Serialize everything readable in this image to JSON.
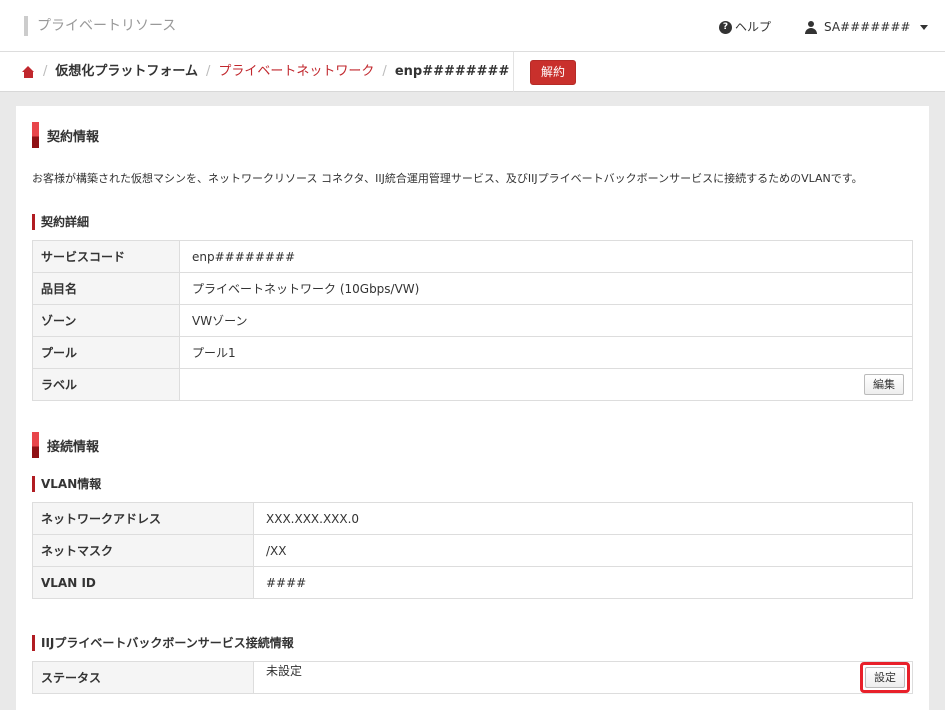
{
  "header": {
    "app_title": "プライベートリソース",
    "help_label": "ヘルプ",
    "user_name": "SA#######"
  },
  "breadcrumb": {
    "items": [
      "仮想化プラットフォーム",
      "プライベートネットワーク",
      "enp########"
    ],
    "separator": "/",
    "cancel_button": "解約"
  },
  "contract": {
    "title": "契約情報",
    "description": "お客様が構築された仮想マシンを、ネットワークリソース コネクタ、IIJ統合運用管理サービス、及びIIJプライベートバックボーンサービスに接続するためのVLANです。",
    "detail_title": "契約詳細",
    "rows": [
      {
        "key": "サービスコード",
        "value": "enp########"
      },
      {
        "key": "品目名",
        "value": "プライベートネットワーク (10Gbps/VW)"
      },
      {
        "key": "ゾーン",
        "value": "VWゾーン"
      },
      {
        "key": "プール",
        "value": "プール1"
      },
      {
        "key": "ラベル",
        "value": ""
      }
    ],
    "edit_button": "編集"
  },
  "connection": {
    "title": "接続情報",
    "vlan_title": "VLAN情報",
    "vlan_rows": [
      {
        "key": "ネットワークアドレス",
        "value": "XXX.XXX.XXX.0"
      },
      {
        "key": "ネットマスク",
        "value": "/XX"
      },
      {
        "key": "VLAN ID",
        "value": "####"
      }
    ],
    "backbone_title": "IIJプライベートバックボーンサービス接続情報",
    "backbone_rows": [
      {
        "key": "ステータス",
        "value": "未設定"
      }
    ],
    "set_button": "設定"
  },
  "colors": {
    "accent": "#c1272d",
    "highlight": "#e8202a"
  }
}
